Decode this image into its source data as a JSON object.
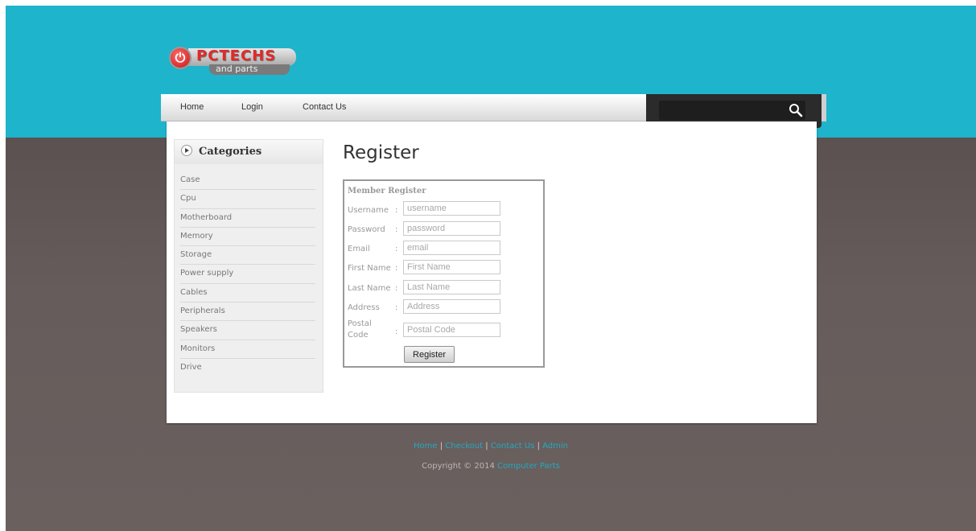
{
  "logo": {
    "main": "PCTECHS",
    "sub": "and parts",
    "power_glyph": "⏻"
  },
  "nav": {
    "items": [
      {
        "label": "Home"
      },
      {
        "label": "Login"
      },
      {
        "label": "Contact Us"
      }
    ]
  },
  "search": {
    "value": "",
    "icon": "search-icon"
  },
  "sidebar": {
    "title": "Categories",
    "items": [
      {
        "label": "Case"
      },
      {
        "label": "Cpu"
      },
      {
        "label": "Motherboard"
      },
      {
        "label": "Memory"
      },
      {
        "label": "Storage"
      },
      {
        "label": "Power supply"
      },
      {
        "label": "Cables"
      },
      {
        "label": "Peripherals"
      },
      {
        "label": "Speakers"
      },
      {
        "label": "Monitors"
      },
      {
        "label": "Drive"
      }
    ]
  },
  "page": {
    "title": "Register"
  },
  "form": {
    "title": "Member Register",
    "colon": ":",
    "fields": [
      {
        "label": "Username",
        "placeholder": "username",
        "value": ""
      },
      {
        "label": "Password",
        "placeholder": "password",
        "value": ""
      },
      {
        "label": "Email",
        "placeholder": "email",
        "value": ""
      },
      {
        "label": "First Name",
        "placeholder": "First Name",
        "value": ""
      },
      {
        "label": "Last Name",
        "placeholder": "Last Name",
        "value": ""
      },
      {
        "label": "Address",
        "placeholder": "Address",
        "value": ""
      },
      {
        "label": "Postal Code",
        "placeholder": "Postal Code",
        "value": ""
      }
    ],
    "submit_label": "Register"
  },
  "footer": {
    "links": [
      {
        "label": "Home"
      },
      {
        "label": "Checkout"
      },
      {
        "label": "Contact Us"
      },
      {
        "label": "Admin"
      }
    ],
    "separator": " | ",
    "copyright": "Copyright © 2014",
    "brand_link": "Computer Parts"
  },
  "colors": {
    "accent": "#1eb4cb",
    "link": "#22a9c2",
    "background": "#655b5a"
  }
}
